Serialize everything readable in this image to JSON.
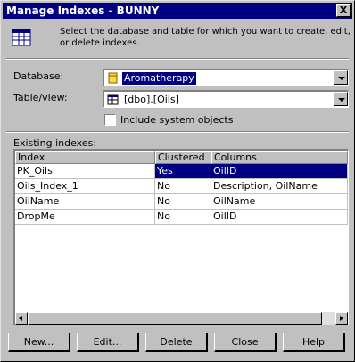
{
  "window": {
    "title": "Manage Indexes - BUNNY",
    "close_label": "X"
  },
  "header": {
    "instruction": "Select the database and table for which you want to create, edit, or delete indexes."
  },
  "database": {
    "label": "Database:",
    "value": "Aromatherapy"
  },
  "table_view": {
    "label": "Table/view:",
    "value": "[dbo].[Oils]"
  },
  "include_system": {
    "label": "Include system objects",
    "checked": false
  },
  "existing": {
    "label": "Existing indexes:",
    "columns": [
      "Index",
      "Clustered",
      "Columns"
    ],
    "rows": [
      {
        "index": "PK_Oils",
        "clustered": "Yes",
        "columns": "OilID",
        "selected": true
      },
      {
        "index": "Oils_Index_1",
        "clustered": "No",
        "columns": "Description, OilName",
        "selected": false
      },
      {
        "index": "OilName",
        "clustered": "No",
        "columns": "OilName",
        "selected": false
      },
      {
        "index": "DropMe",
        "clustered": "No",
        "columns": "OilID",
        "selected": false
      }
    ]
  },
  "buttons": {
    "new": "New...",
    "edit": "Edit...",
    "delete": "Delete",
    "close": "Close",
    "help": "Help"
  },
  "icons": {
    "header": "table-index-icon",
    "database": "database-icon",
    "table": "table-icon"
  },
  "colors": {
    "titlebar": "#000080",
    "selection": "#000080",
    "face": "#c0c0c0"
  }
}
